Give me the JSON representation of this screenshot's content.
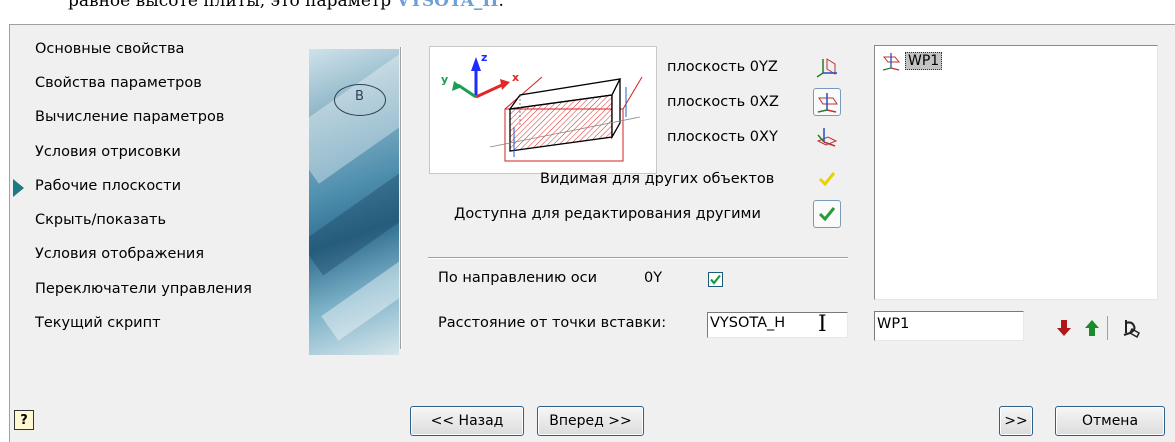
{
  "doc_text": {
    "before": "равное высоте плиты, это параметр ",
    "highlight": "VYSOTA_H",
    "after": "."
  },
  "nav": {
    "items": [
      {
        "label": "Основные свойства"
      },
      {
        "label": "Свойства параметров"
      },
      {
        "label": "Вычисление параметров"
      },
      {
        "label": "Условия отрисовки"
      },
      {
        "label": "Рабочие плоскости",
        "active": true
      },
      {
        "label": "Скрыть/показать"
      },
      {
        "label": "Условия отображения"
      },
      {
        "label": "Переключатели управления"
      },
      {
        "label": "Текущий скрипт"
      }
    ]
  },
  "side_image": {
    "letter": "B"
  },
  "preview": {
    "axis_z": "z",
    "axis_y": "y",
    "axis_x": "x"
  },
  "planes": {
    "oyz_label": "плоскость 0YZ",
    "oxz_label": "плоскость 0XZ",
    "oxy_label": "плоскость 0XY"
  },
  "visible_label": "Видимая для других объектов",
  "editable_label": "Доступна для редактирования другими",
  "direction": {
    "label": "По направлению оси",
    "axis": "0Y",
    "checked": true
  },
  "distance": {
    "label": "Расстояние от точки вставки:",
    "value": "VYSOTA_H"
  },
  "list": {
    "items": [
      {
        "name": "WP1",
        "selected": true
      }
    ]
  },
  "name_field": {
    "value": "WP1"
  },
  "footer": {
    "help": "?",
    "back": "<< Назад",
    "next": "Вперед >>",
    "more": ">>",
    "cancel": "Отмена"
  },
  "colors": {
    "accent": "#1c7a80",
    "button_border": "#2c628b",
    "hatch_red": "#e0282a",
    "down_arrow": "#b01818",
    "up_arrow": "#1a8a2a"
  }
}
